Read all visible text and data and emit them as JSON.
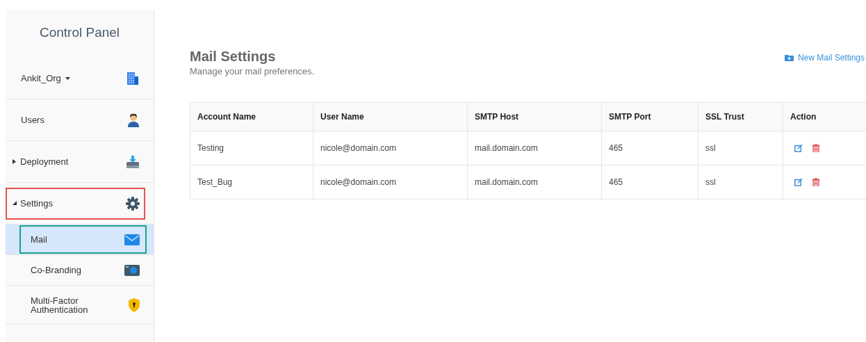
{
  "sidebar": {
    "title": "Control Panel",
    "items": [
      {
        "kind": "org",
        "label": "Ankit_Org",
        "selected": false,
        "outlined": false
      },
      {
        "kind": "item",
        "label": "Users",
        "selected": false,
        "outlined": false
      },
      {
        "kind": "group",
        "label": "Deployment",
        "expanded": false,
        "selected": false,
        "outlined": false
      },
      {
        "kind": "group",
        "label": "Settings",
        "expanded": true,
        "selected": false,
        "outlined": true,
        "children": [
          {
            "label": "Mail",
            "selected": true,
            "outlined": true
          },
          {
            "label": "Co-Branding",
            "selected": false,
            "outlined": false
          },
          {
            "label": "Multi-Factor Authentication",
            "selected": false,
            "outlined": false
          }
        ]
      }
    ]
  },
  "page": {
    "title": "Mail Settings",
    "subtitle": "Manage your mail preferences.",
    "new_button": "New Mail Settings"
  },
  "table": {
    "columns": [
      "Account Name",
      "User Name",
      "SMTP Host",
      "SMTP Port",
      "SSL Trust",
      "Action"
    ],
    "rows": [
      {
        "cells": [
          "Testing",
          "nicole@domain.com",
          "mail.domain.com",
          "465",
          "ssl"
        ]
      },
      {
        "cells": [
          "Test_Bug",
          "nicole@domain.com",
          "mail.domain.com",
          "465",
          "ssl"
        ]
      }
    ]
  }
}
